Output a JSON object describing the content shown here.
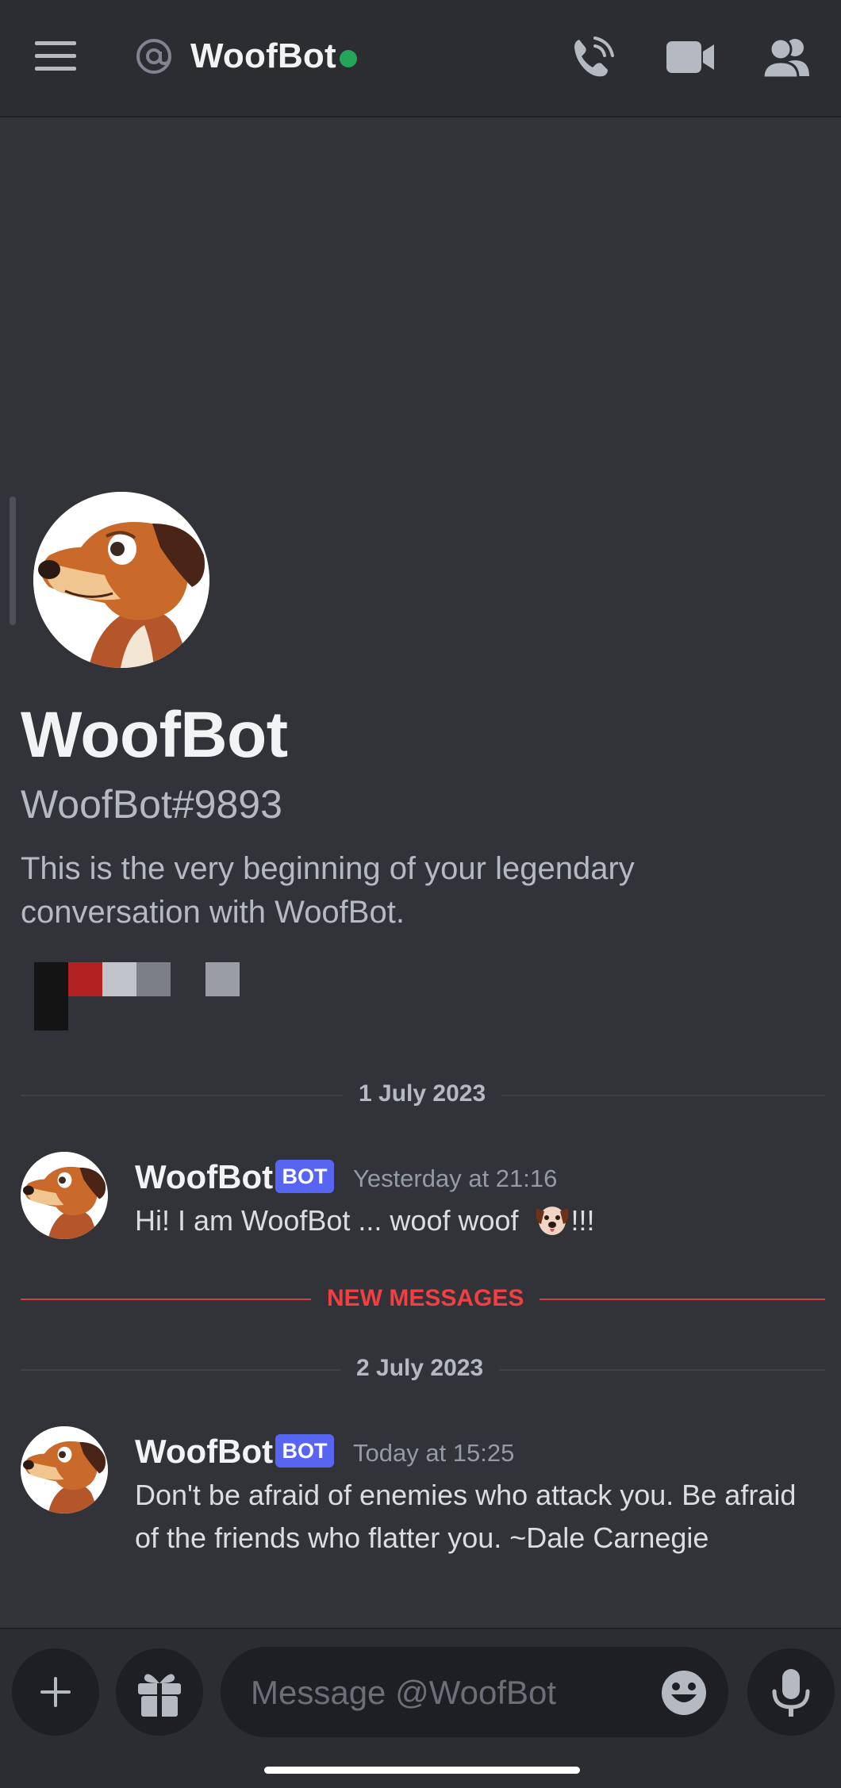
{
  "header": {
    "title": "WoofBot",
    "status": "online",
    "icons": [
      "menu-icon",
      "at-mention-icon",
      "phone-call-icon",
      "video-call-icon",
      "members-icon"
    ]
  },
  "profile": {
    "name": "WoofBot",
    "tag": "WoofBot#9893",
    "intro": "This is the very beginning of your legendary conversation with WoofBot."
  },
  "dividers": {
    "first_date": "1 July 2023",
    "new_messages": "NEW MESSAGES",
    "second_date": "2 July 2023"
  },
  "messages": [
    {
      "author": "WoofBot",
      "badge": "BOT",
      "time": "Yesterday at 21:16",
      "body": "Hi! I am WoofBot ... woof woof",
      "emoji": "dog-face-emoji",
      "suffix": "!!!"
    },
    {
      "author": "WoofBot",
      "badge": "BOT",
      "time": "Today at 15:25",
      "body": "Don't be afraid of enemies who attack you. Be afraid of the friends who flatter you.  ~Dale Carnegie"
    }
  ],
  "composer": {
    "placeholder": "Message @WoofBot",
    "value": ""
  },
  "colors": {
    "background": "#313338",
    "header": "#2b2d31",
    "online": "#23a55a",
    "bot_badge": "#5865f2",
    "new_messages": "#f23f43"
  }
}
